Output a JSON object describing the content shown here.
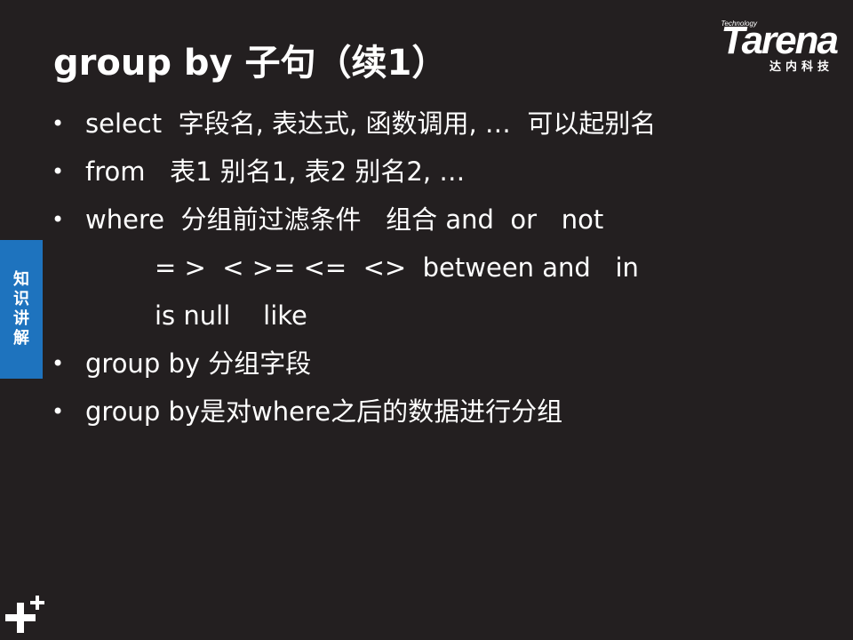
{
  "slide": {
    "title": "group by 子句（续1）",
    "logo": {
      "small": "Technology",
      "main": "Tarena",
      "sub": "达内科技"
    },
    "side_tab": [
      "知",
      "识",
      "讲",
      "解"
    ],
    "bullets": [
      {
        "text": "select  字段名, 表达式, 函数调用, …  可以起别名"
      },
      {
        "text": "from   表1 别名1, 表2 别名2, …"
      },
      {
        "text": "where  分组前过滤条件   组合 and  or   not"
      },
      {
        "text": "= >  < >= <=  <>  between and   in"
      },
      {
        "text": "is null    like"
      },
      {
        "text": "group by 分组字段"
      },
      {
        "text": "group by是对where之后的数据进行分组"
      }
    ],
    "bullet_glyph": "•",
    "colors": {
      "background": "#231f20",
      "text": "#ffffff",
      "side_tab": "#1e73be"
    },
    "icons": {
      "corner": "plus-icon"
    }
  }
}
